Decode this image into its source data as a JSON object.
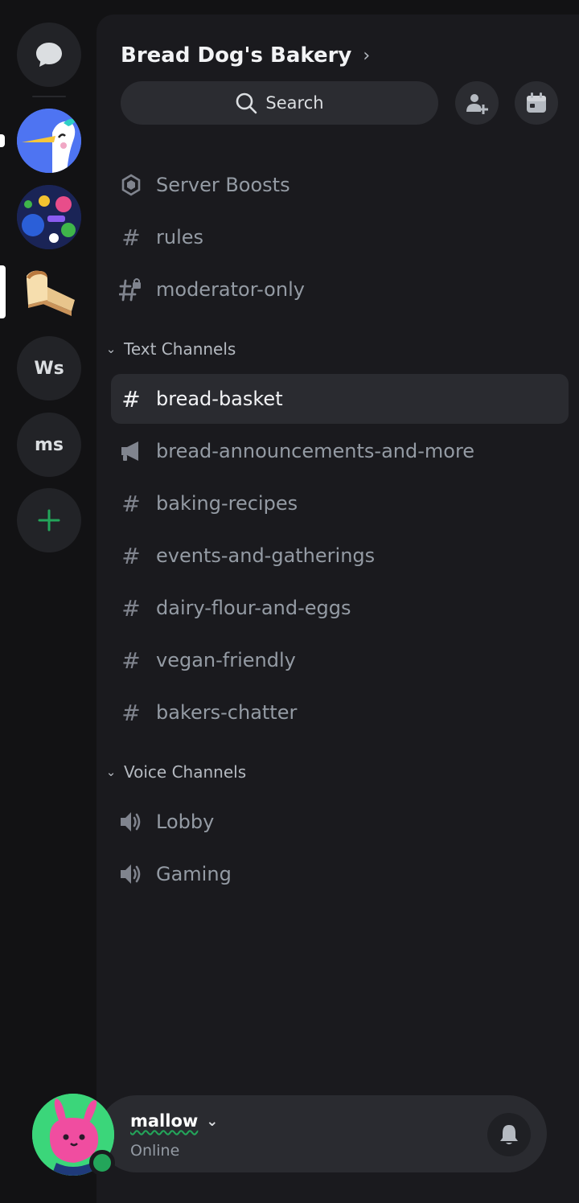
{
  "servers": {
    "direct_messages_icon": "chat-bubble-icon",
    "workspace_initials": [
      "Ws",
      "ms"
    ],
    "add_server_icon": "plus-icon"
  },
  "server": {
    "name": "Bread Dog's Bakery",
    "chevron": "›",
    "search_label": "Search",
    "invite_icon": "add-member-icon",
    "events_icon": "calendar-icon"
  },
  "top_items": [
    {
      "label": "Server Boosts",
      "icon": "boost-shield-icon"
    },
    {
      "label": "rules",
      "icon": "hash-icon"
    },
    {
      "label": "moderator-only",
      "icon": "locked-hash-icon"
    }
  ],
  "text_category": {
    "label": "Text Channels",
    "caret": "⌄"
  },
  "text_channels": [
    {
      "label": "bread-basket",
      "icon": "hash-icon",
      "selected": true
    },
    {
      "label": "bread-announcements-and-more",
      "icon": "announcement-icon"
    },
    {
      "label": "baking-recipes",
      "icon": "hash-icon"
    },
    {
      "label": "events-and-gatherings",
      "icon": "hash-icon"
    },
    {
      "label": "dairy-flour-and-eggs",
      "icon": "hash-icon"
    },
    {
      "label": "vegan-friendly",
      "icon": "hash-icon"
    },
    {
      "label": "bakers-chatter",
      "icon": "hash-icon"
    }
  ],
  "voice_category": {
    "label": "Voice Channels",
    "caret": "⌄"
  },
  "voice_channels": [
    {
      "label": "Lobby",
      "icon": "speaker-icon"
    },
    {
      "label": "Gaming",
      "icon": "speaker-icon"
    }
  ],
  "user": {
    "name": "mallow",
    "caret": "⌄",
    "status": "Online",
    "status_color": "#23a55a",
    "bell_icon": "bell-icon"
  },
  "colors": {
    "background": "#121214",
    "panel": "#1a1a1e",
    "selected_row": "#2a2b30",
    "accent_green": "#23a55a"
  }
}
